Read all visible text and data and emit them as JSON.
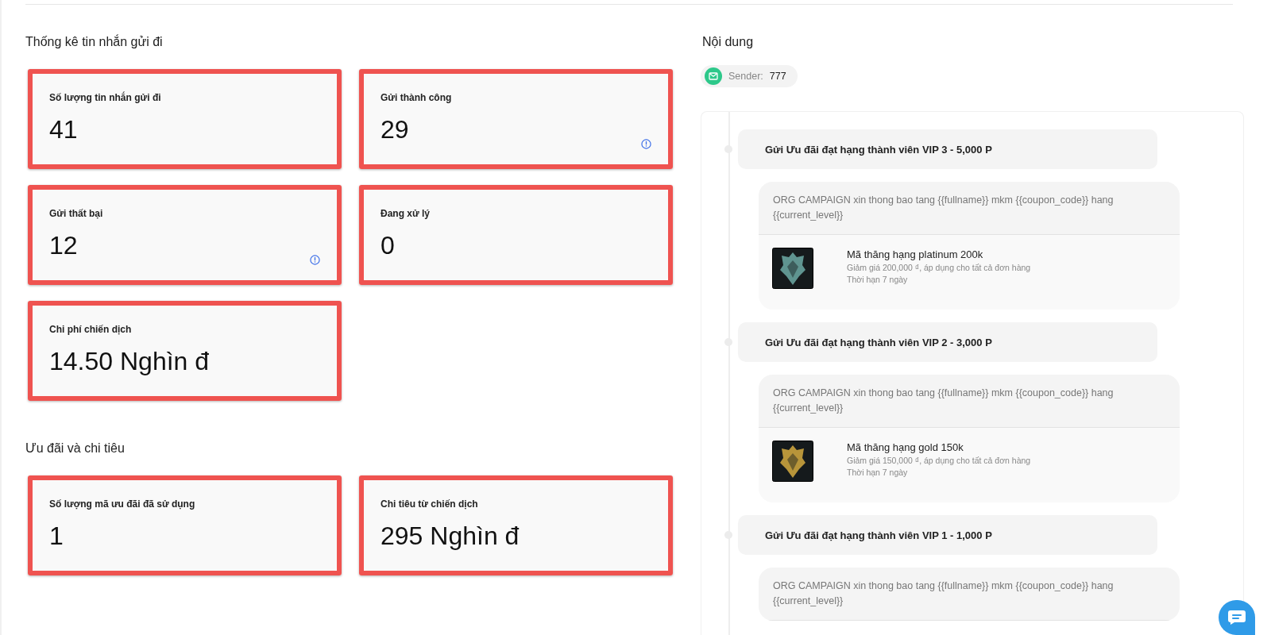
{
  "stats_section": {
    "title": "Thống kê tin nhắn gửi đi",
    "cards": [
      {
        "label": "Số lượng tin nhắn gửi đi",
        "value": "41",
        "info_icon": false,
        "highlighted": true
      },
      {
        "label": "Gửi thành công",
        "value": "29",
        "info_icon": true,
        "highlighted": true
      },
      {
        "label": "Gửi thất bại",
        "value": "12",
        "info_icon": true,
        "highlighted": true
      },
      {
        "label": "Đang xử lý",
        "value": "0",
        "info_icon": false,
        "highlighted": true
      },
      {
        "label": "Chi phí chiến dịch",
        "value": "14.50 Nghìn đ",
        "info_icon": false,
        "highlighted": true
      }
    ]
  },
  "offers_section": {
    "title": "Ưu đãi và chi tiêu",
    "cards": [
      {
        "label": "Số lượng mã ưu đãi đã sử dụng",
        "value": "1",
        "info_icon": false,
        "highlighted": true
      },
      {
        "label": "Chi tiêu từ chiến dịch",
        "value": "295 Nghìn đ",
        "info_icon": false,
        "highlighted": true
      }
    ]
  },
  "content": {
    "title": "Nội dung",
    "sender": {
      "label": "Sender:",
      "value": "777"
    },
    "messages": [
      {
        "heading": "Gửi Ưu đãi đạt hạng thành viên VIP 3 - 5,000 P",
        "text": "ORG CAMPAIGN xin thong bao tang {{fullname}} mkm {{coupon_code}} hang {{current_level}}",
        "coupon": {
          "name": "Mã thăng hạng platinum 200k",
          "description": "Giảm giá 200,000 ₫, áp dụng cho tất cả đơn hàng",
          "validity": "Thời hạn 7 ngày",
          "color": "#5f9490"
        }
      },
      {
        "heading": "Gửi Ưu đãi đạt hạng thành viên VIP 2 - 3,000 P",
        "text": "ORG CAMPAIGN xin thong bao tang {{fullname}} mkm {{coupon_code}} hang {{current_level}}",
        "coupon": {
          "name": "Mã thăng hạng gold 150k",
          "description": "Giảm giá 150,000 ₫, áp dụng cho tất cả đơn hàng",
          "validity": "Thời hạn 7 ngày",
          "color": "#b8953a"
        }
      },
      {
        "heading": "Gửi Ưu đãi đạt hạng thành viên VIP 1 - 1,000 P",
        "text": "ORG CAMPAIGN xin thong bao tang {{fullname}} mkm {{coupon_code}} hang {{current_level}}"
      }
    ]
  }
}
